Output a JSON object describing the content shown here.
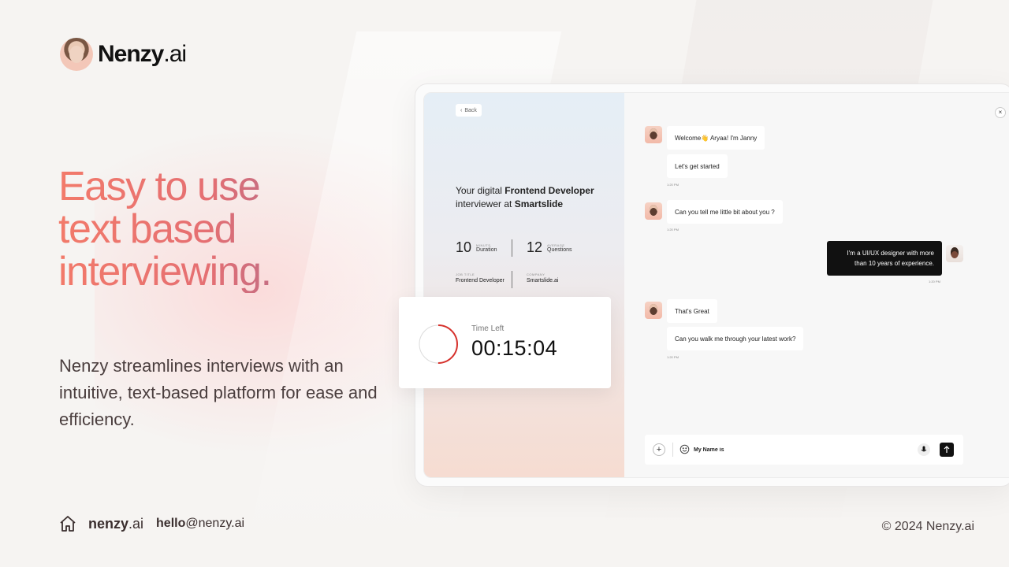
{
  "brand": {
    "name_bold": "Nenzy",
    "name_light": ".ai"
  },
  "headline": {
    "line1": "Easy to use",
    "line2": "text based",
    "line3": "interviewing."
  },
  "subtext": "Nenzy streamlines interviews with an intuitive, text-based platform for ease and efficiency.",
  "footer": {
    "brand_bold": "nenzy",
    "brand_light": ".ai",
    "email_bold": "hello",
    "email_rest": "@nenzy.ai",
    "copyright": "© 2024 Nenzy.ai"
  },
  "app": {
    "back_label": "Back",
    "title_prefix": "Your digital ",
    "title_role": "Frontend Developer",
    "title_mid": "interviewer at ",
    "title_company": "Smartslide",
    "stats": [
      {
        "number": "10",
        "small": "MINUTS",
        "label": "Duration"
      },
      {
        "number": "12",
        "small": "AVERAGE",
        "label": "Questions"
      }
    ],
    "info": [
      {
        "small": "JOB TITLE",
        "value": "Frontend Developer"
      },
      {
        "small": "COMPANY",
        "value": "Smartslide.ai"
      }
    ],
    "close_label": "×",
    "messages": {
      "m1": "Welcome👋 Aryaa! I'm Janny",
      "m2": "Let's get started",
      "ts1": "1:20 PM",
      "m3": "Can you tell me little bit about you ?",
      "ts2": "1:20 PM",
      "m4": "I'm a UI/UX designer with more than 10 years of experience.",
      "ts3": "1:20 PM",
      "m5": "That's Great",
      "m6": "Can you walk me through your latest work?",
      "ts4": "1:20 PM"
    },
    "input": {
      "value": "My Name is",
      "plus": "+"
    }
  },
  "timer": {
    "label": "Time Left",
    "value": "00:15:04",
    "remaining_fraction": 0.5,
    "accent": "#d6312c"
  }
}
